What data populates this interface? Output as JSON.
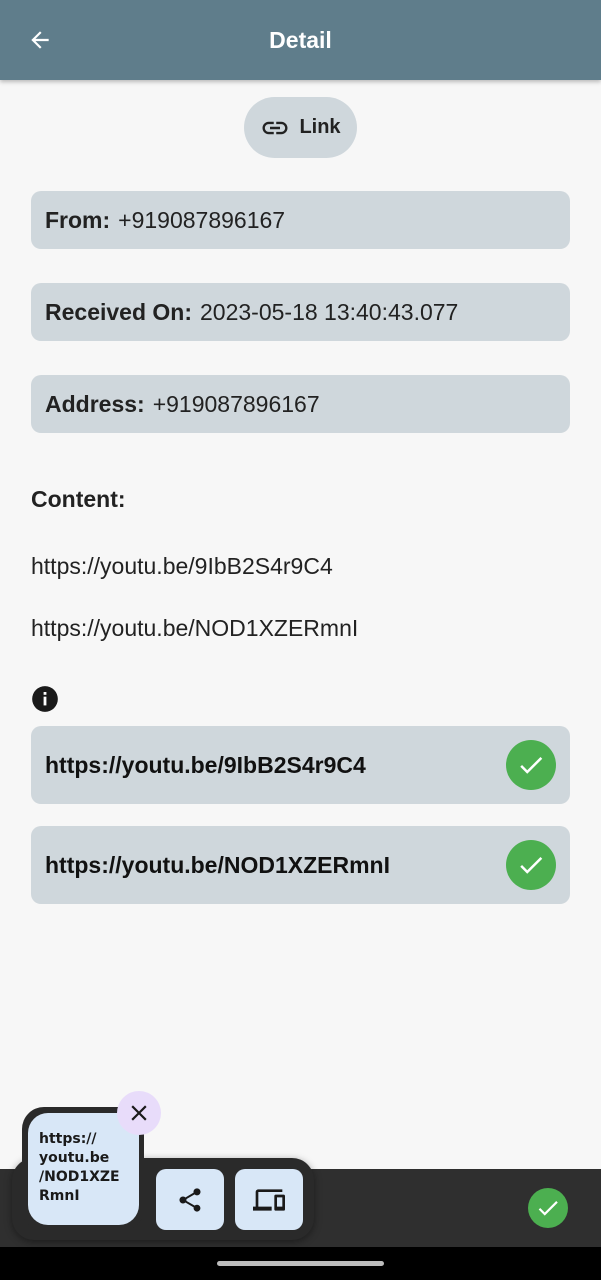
{
  "appbar": {
    "title": "Detail",
    "back_icon": "arrow-left-icon"
  },
  "chip": {
    "label": "Link",
    "icon": "link-icon"
  },
  "details": {
    "from": {
      "label": "From:",
      "value": "+919087896167"
    },
    "received": {
      "label": "Received On:",
      "value": "2023-05-18 13:40:43.077"
    },
    "address": {
      "label": "Address:",
      "value": "+919087896167"
    }
  },
  "content": {
    "label": "Content:",
    "lines": [
      "https://youtu.be/9IbB2S4r9C4",
      "https://youtu.be/NOD1XZERmnI"
    ]
  },
  "links": [
    {
      "url": "https://youtu.be/9IbB2S4r9C4",
      "icon": "check-icon"
    },
    {
      "url": "https://youtu.be/NOD1XZERmnI",
      "icon": "check-icon"
    }
  ],
  "bubble": {
    "lines": [
      "https://",
      "youtu.be",
      "/NOD1XZE",
      "RmnI"
    ]
  },
  "colors": {
    "appbar": "#5f7d8b",
    "card": "#cfd7dc",
    "check": "#4caf50",
    "bubble": "#d8e7f7",
    "close": "#e8dcfa"
  }
}
